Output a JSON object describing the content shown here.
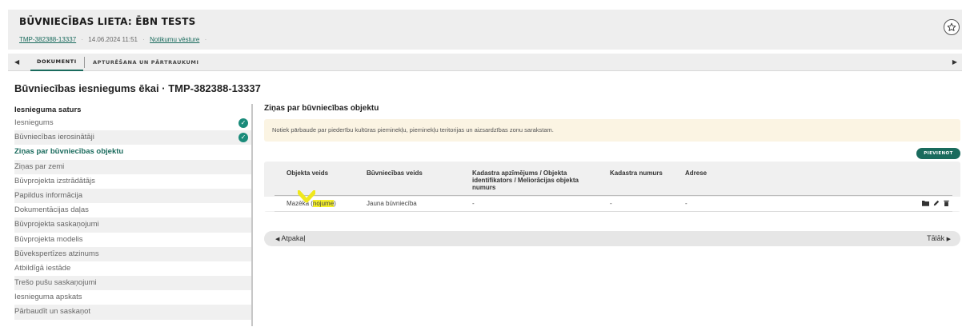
{
  "header": {
    "title": "BŪVNIECĪBAS LIETA: ĒBN TESTS",
    "case_id": "TMP-382388-13337",
    "datetime": "14.06.2024 11:51",
    "history_link": "Notikumu vēsture",
    "star_icon": "star-icon"
  },
  "tabs": {
    "items": [
      {
        "label": "DOKUMENTI"
      },
      {
        "label": "APTURĒŠANA UN PĀRTRAUKUMI"
      }
    ],
    "left_arrow": "◀",
    "right_arrow": "▶"
  },
  "page_title": "Būvniecības iesniegums ēkai · TMP-382388-13337",
  "sidebar": {
    "heading": "Iesnieguma saturs",
    "items": [
      {
        "label": "Iesniegums",
        "checked": true
      },
      {
        "label": "Būvniecības ierosinātāji",
        "checked": true
      },
      {
        "label": "Ziņas par būvniecības objektu",
        "active": true
      },
      {
        "label": "Ziņas par zemi"
      },
      {
        "label": "Būvprojekta izstrādātājs"
      },
      {
        "label": "Papildus informācija"
      },
      {
        "label": "Dokumentācijas daļas"
      },
      {
        "label": "Būvprojekta saskaņojumi"
      },
      {
        "label": "Būvprojekta modelis"
      },
      {
        "label": "Būvekspertīzes atzinums"
      },
      {
        "label": "Atbildīgā iestāde"
      },
      {
        "label": "Trešo pušu saskaņojumi"
      },
      {
        "label": "Iesnieguma apskats"
      },
      {
        "label": "Pārbaudīt un saskaņot"
      }
    ]
  },
  "main": {
    "section_title": "Ziņas par būvniecības objektu",
    "notice": "Notiek pārbaude par piederību kultūras pieminekļu, pieminekļu teritorijas un aizsardzības zonu sarakstam.",
    "add_button": "PIEVIENOT",
    "table": {
      "headers": [
        "Objekta veids",
        "Būvniecības veids",
        "Kadastra apzīmējums / Objekta identifikators / Meliorācijas objekta numurs",
        "Kadastra numurs",
        "Adrese"
      ],
      "rows": [
        {
          "object_type_main": "Mazēka (",
          "object_type_hl": "nojume",
          "object_type_end": ")",
          "build_type": "Jauna būvniecība",
          "cadastre_designation": "-",
          "cadastre_number": "-",
          "address": "-"
        }
      ]
    },
    "pager": {
      "prev": "Atpakaļ",
      "next": "Tālāk"
    }
  },
  "colors": {
    "accent": "#1a6b5d",
    "notice_bg": "#fbf4e3",
    "highlight": "#f4ef2a"
  }
}
